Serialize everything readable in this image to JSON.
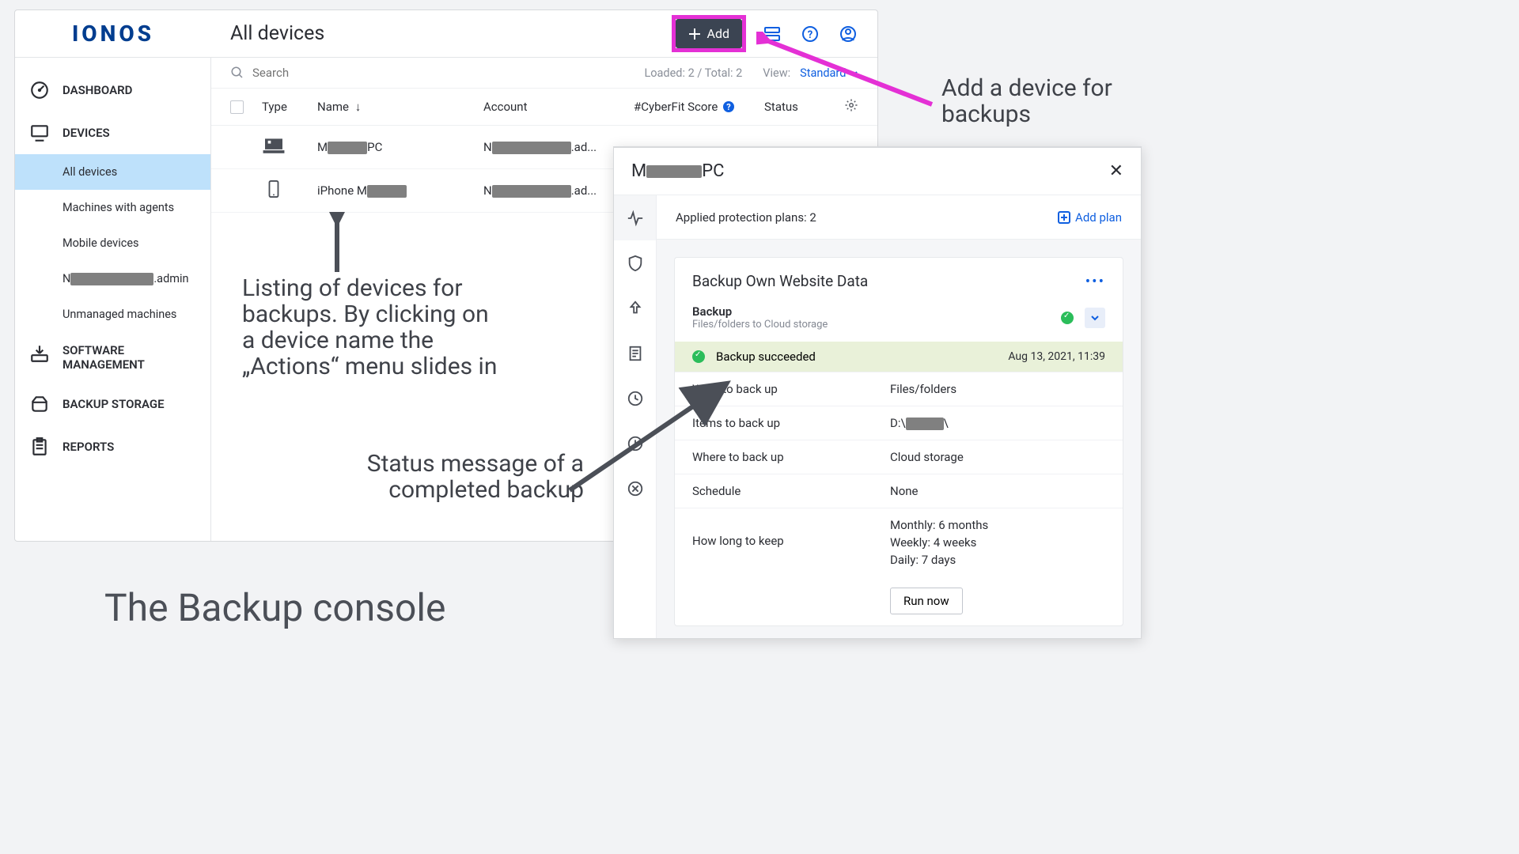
{
  "header": {
    "logo": "IONOS",
    "title": "All devices",
    "add_label": "Add"
  },
  "sidebar": {
    "dashboard": "DASHBOARD",
    "devices": "DEVICES",
    "all_devices": "All devices",
    "machines_agents": "Machines with agents",
    "mobile_devices": "Mobile devices",
    "admin_pre": "N",
    "admin_suf": ".admin",
    "unmanaged": "Unmanaged machines",
    "software": "SOFTWARE MANAGEMENT",
    "backup_storage": "BACKUP STORAGE",
    "reports": "REPORTS"
  },
  "toolbar": {
    "search_placeholder": "Search",
    "loaded": "Loaded: 2 / Total: 2",
    "view_label": "View:",
    "view_value": "Standard"
  },
  "columns": {
    "type": "Type",
    "name": "Name",
    "account": "Account",
    "cyberfit": "#CyberFit Score",
    "status": "Status"
  },
  "rows": [
    {
      "name_pre": "M",
      "name_suf": "PC",
      "acct_pre": "N",
      "acct_suf": ".ad...",
      "type": "laptop"
    },
    {
      "name_pre": "iPhone M",
      "name_suf": "",
      "acct_pre": "N",
      "acct_suf": ".ad...",
      "type": "phone"
    }
  ],
  "panel": {
    "title_pre": "M",
    "title_suf": "PC",
    "applied_plans": "Applied protection plans: 2",
    "add_plan": "Add plan",
    "plan_name": "Backup Own Website Data",
    "backup_label": "Backup",
    "backup_desc": "Files/folders to Cloud storage",
    "success_msg": "Backup succeeded",
    "success_ts": "Aug 13, 2021, 11:39",
    "details": {
      "what_label": "What to back up",
      "what_value": "Files/folders",
      "items_label": "Items to back up",
      "items_pre": "D:\\",
      "items_suf": "\\",
      "where_label": "Where to back up",
      "where_value": "Cloud storage",
      "schedule_label": "Schedule",
      "schedule_value": "None",
      "keep_label": "How long to keep",
      "keep_monthly": "Monthly: 6 months",
      "keep_weekly": "Weekly: 4 weeks",
      "keep_daily": "Daily: 7 days"
    },
    "run_now": "Run now"
  },
  "annotations": {
    "add_annot": "Add a device for backups",
    "listing_annot": "Listing of devices for backups. By clicking on a device name the „Actions“ menu slides in",
    "status_annot": "Status message of a completed backup",
    "caption": "The Backup console"
  }
}
